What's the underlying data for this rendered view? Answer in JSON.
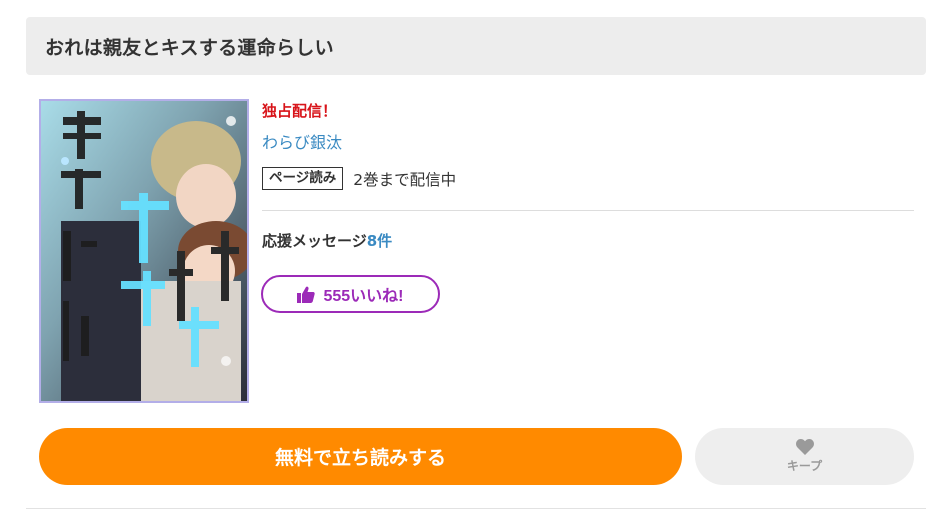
{
  "title": "おれは親友とキスする運命らしい",
  "cover": {
    "logo_text": "おれは親友とキスする運命らしい",
    "author_logo": "わらび銀汰"
  },
  "badge_exclusive": "独占配信！",
  "author": "わらび銀汰",
  "read_tag": "ページ読み",
  "volume_text": "2巻まで配信中",
  "message": {
    "label": "応援メッセージ",
    "count": "8件"
  },
  "like_button": {
    "icon": "thumbs-up-icon",
    "label": "555いいね!"
  },
  "read_button_label": "無料で立ち読みする",
  "keep_button": {
    "icon": "heart-icon",
    "label": "キープ"
  },
  "colors": {
    "primary_orange": "#ff8a00",
    "like_purple": "#9c2ab8",
    "exclusive_red": "#d8141a",
    "link_blue": "#3a8ac2"
  }
}
